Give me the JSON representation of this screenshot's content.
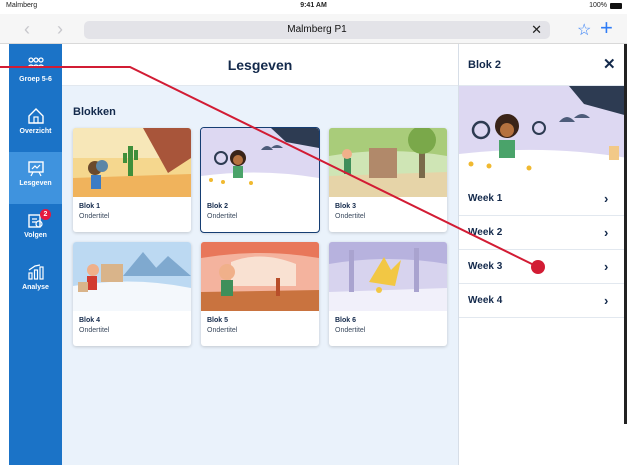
{
  "status_bar": {
    "carrier": "Malmberg",
    "time": "9:41 AM",
    "battery": "100%"
  },
  "browser": {
    "url_title": "Malmberg P1",
    "back_label": "‹",
    "forward_label": "›",
    "clear_label": "✕",
    "star_label": "☆",
    "add_label": "+"
  },
  "sidebar": {
    "items": [
      {
        "label": "Groep 5-6",
        "icon": "group-icon"
      },
      {
        "label": "Overzicht",
        "icon": "home-icon"
      },
      {
        "label": "Lesgeven",
        "icon": "board-icon"
      },
      {
        "label": "Volgen",
        "icon": "progress-icon",
        "badge": "2"
      },
      {
        "label": "Analyse",
        "icon": "chart-icon"
      }
    ],
    "active_index": 2
  },
  "main": {
    "title": "Lesgeven",
    "section_title": "Blokken",
    "cards": [
      {
        "title": "Blok 1",
        "subtitle": "Ondertitel"
      },
      {
        "title": "Blok 2",
        "subtitle": "Ondertitel"
      },
      {
        "title": "Blok 3",
        "subtitle": "Ondertitel"
      },
      {
        "title": "Blok 4",
        "subtitle": "Ondertitel"
      },
      {
        "title": "Blok 5",
        "subtitle": "Ondertitel"
      },
      {
        "title": "Blok 6",
        "subtitle": "Ondertitel"
      }
    ],
    "selected_card": 1
  },
  "panel": {
    "title": "Blok 2",
    "close_label": "✕",
    "weeks": [
      {
        "label": "Week 1"
      },
      {
        "label": "Week 2"
      },
      {
        "label": "Week 3"
      },
      {
        "label": "Week 4"
      }
    ],
    "chevron": "›"
  },
  "colors": {
    "sidebar": "#1b73c7",
    "sidebar_active": "#3f93de",
    "navy": "#13294b",
    "main_bg": "#eaf2fb",
    "badge": "#e5193e",
    "annotation": "#d21c34"
  }
}
